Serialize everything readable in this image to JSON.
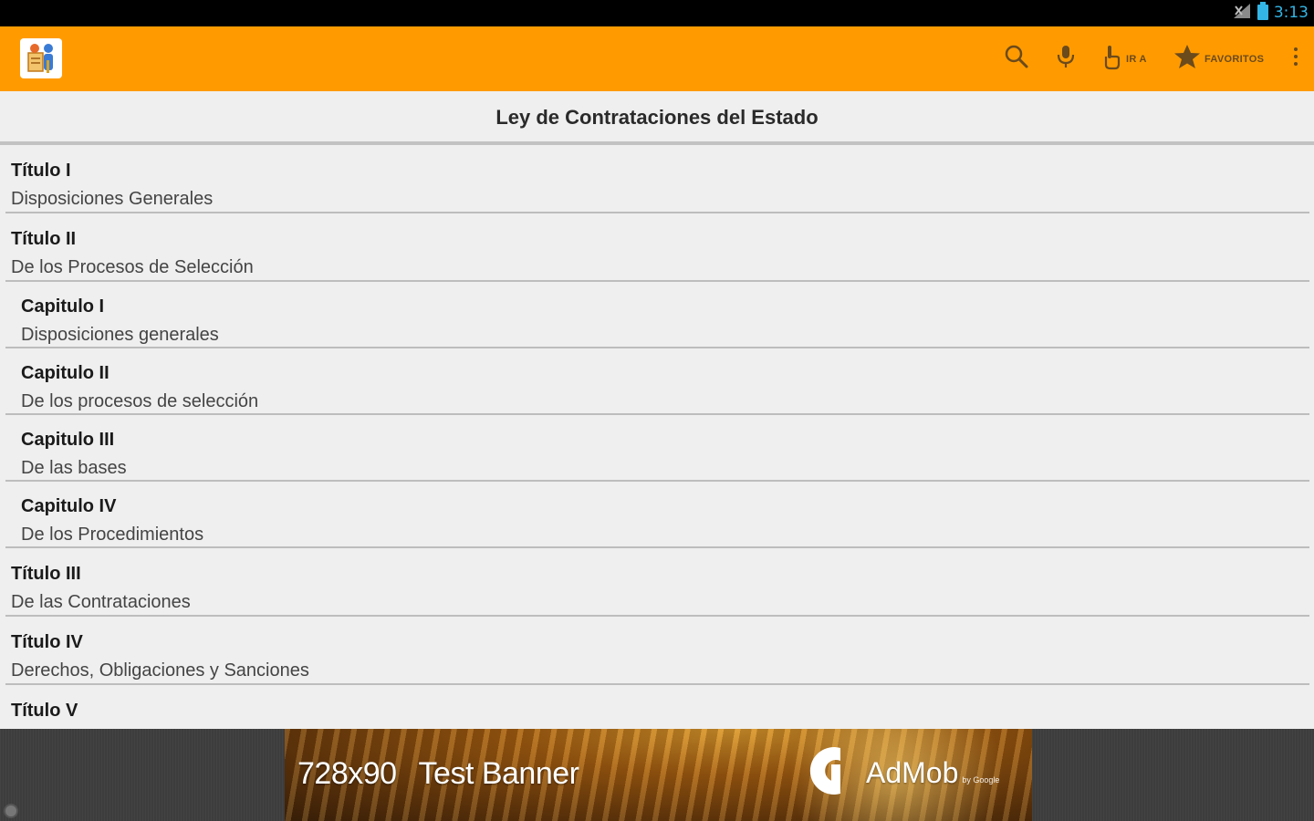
{
  "status_bar": {
    "time": "3:13",
    "icons": [
      "signal-icon",
      "battery-icon"
    ]
  },
  "action_bar": {
    "app_icon": "app-logo-icon",
    "actions": [
      {
        "icon": "search-icon",
        "label": ""
      },
      {
        "icon": "microphone-icon",
        "label": ""
      },
      {
        "icon": "pointer-hand-icon",
        "label": "IR A"
      },
      {
        "icon": "star-icon",
        "label": "FAVORITOS"
      },
      {
        "icon": "overflow-menu-icon",
        "label": ""
      }
    ],
    "background": "#ff9b00"
  },
  "page": {
    "title": "Ley de Contrataciones del Estado"
  },
  "toc": {
    "items": [
      {
        "title": "Título I",
        "subtitle": "Disposiciones Generales",
        "level": 1
      },
      {
        "title": "Título II",
        "subtitle": "De los Procesos de Selección",
        "level": 1
      },
      {
        "title": "Capitulo I",
        "subtitle": "Disposiciones generales",
        "level": 2
      },
      {
        "title": "Capitulo II",
        "subtitle": "De los procesos de selección",
        "level": 2
      },
      {
        "title": "Capitulo III",
        "subtitle": "De las bases",
        "level": 2
      },
      {
        "title": "Capitulo IV",
        "subtitle": "De los Procedimientos",
        "level": 2
      },
      {
        "title": "Título III",
        "subtitle": "De las Contrataciones",
        "level": 1
      },
      {
        "title": "Título IV",
        "subtitle": "Derechos, Obligaciones y Sanciones",
        "level": 1
      },
      {
        "title": "Título V",
        "subtitle": "",
        "level": 1
      }
    ]
  },
  "ad": {
    "size_text": "728x90",
    "banner_text": "Test Banner",
    "brand": "AdMob",
    "brand_by": "by Google"
  }
}
